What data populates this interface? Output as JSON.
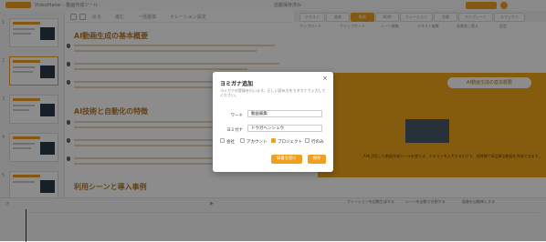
{
  "app": {
    "title": "VideoMaker - 動画作成ツール",
    "status": "自動保存済み"
  },
  "editor": {
    "toolbar": [
      "戻る",
      "進む",
      "一括置換",
      "ナレーション設定"
    ],
    "heading1": "AI動画生成の基本概要",
    "heading2": "AI技術と自動化の特徴",
    "heading3": "利用シーンと導入事例"
  },
  "right_tabs": [
    "テキスト",
    "画像",
    "動画",
    "BGM",
    "ナレーション",
    "字幕",
    "テンプレート",
    "エフェクト"
  ],
  "right_tools": [
    "アップロード",
    "クリップボード",
    "シーン編集",
    "テキスト編集",
    "画像差し替え",
    "設定"
  ],
  "slide": {
    "pill": "AI動画生成の基本概要",
    "caption": "AIを活用した動画作成ツールを使えば、テキストを入力するだけで、短時間で高品質な動画を作成できます。"
  },
  "timeline": {
    "opts": [
      "ナレーションを自動生成する",
      "シーンを自動で分割する",
      "画像を自動挿入する"
    ]
  },
  "modal": {
    "title": "ヨミガナ追加",
    "close": "×",
    "description": "ヨミガナの登録を行います。正しい読み方をカタカナで入力してください。",
    "word_label": "ワード",
    "word_value": "動画編集",
    "yomi_label": "ヨミガナ",
    "yomi_value": "ドウガヘンシュウ",
    "categories": [
      "会社",
      "アカウント",
      "プロジェクト",
      "行のみ"
    ],
    "checked_index": 2,
    "open_dict_label": "辞書を開く",
    "save_label": "保存",
    "accent": "#f0a020"
  }
}
